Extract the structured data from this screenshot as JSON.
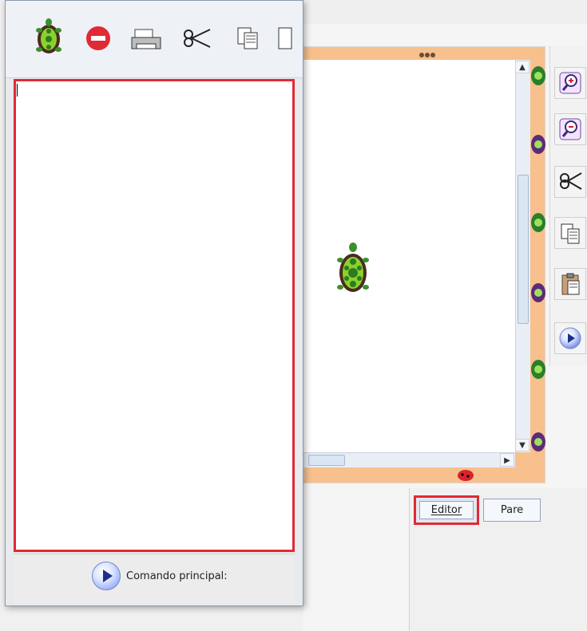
{
  "colors": {
    "frame_orange": "#f7c08c",
    "highlight_red": "#e02a35",
    "button_border": "#8ea5c4",
    "accent_blue": "#6c82df"
  },
  "toolbar": {
    "icons": [
      "turtle-icon",
      "stop-icon",
      "printer-icon",
      "scissors-icon",
      "copy-icon"
    ]
  },
  "right_toolbar": {
    "icons": [
      "zoom-in-icon",
      "zoom-out-icon",
      "cut-icon",
      "copy-icon",
      "paste-icon",
      "play-icon"
    ]
  },
  "controls": {
    "editor_label": "Editor",
    "pare_label": "Pare"
  },
  "status": {
    "main_command_label": "Comando principal:"
  }
}
